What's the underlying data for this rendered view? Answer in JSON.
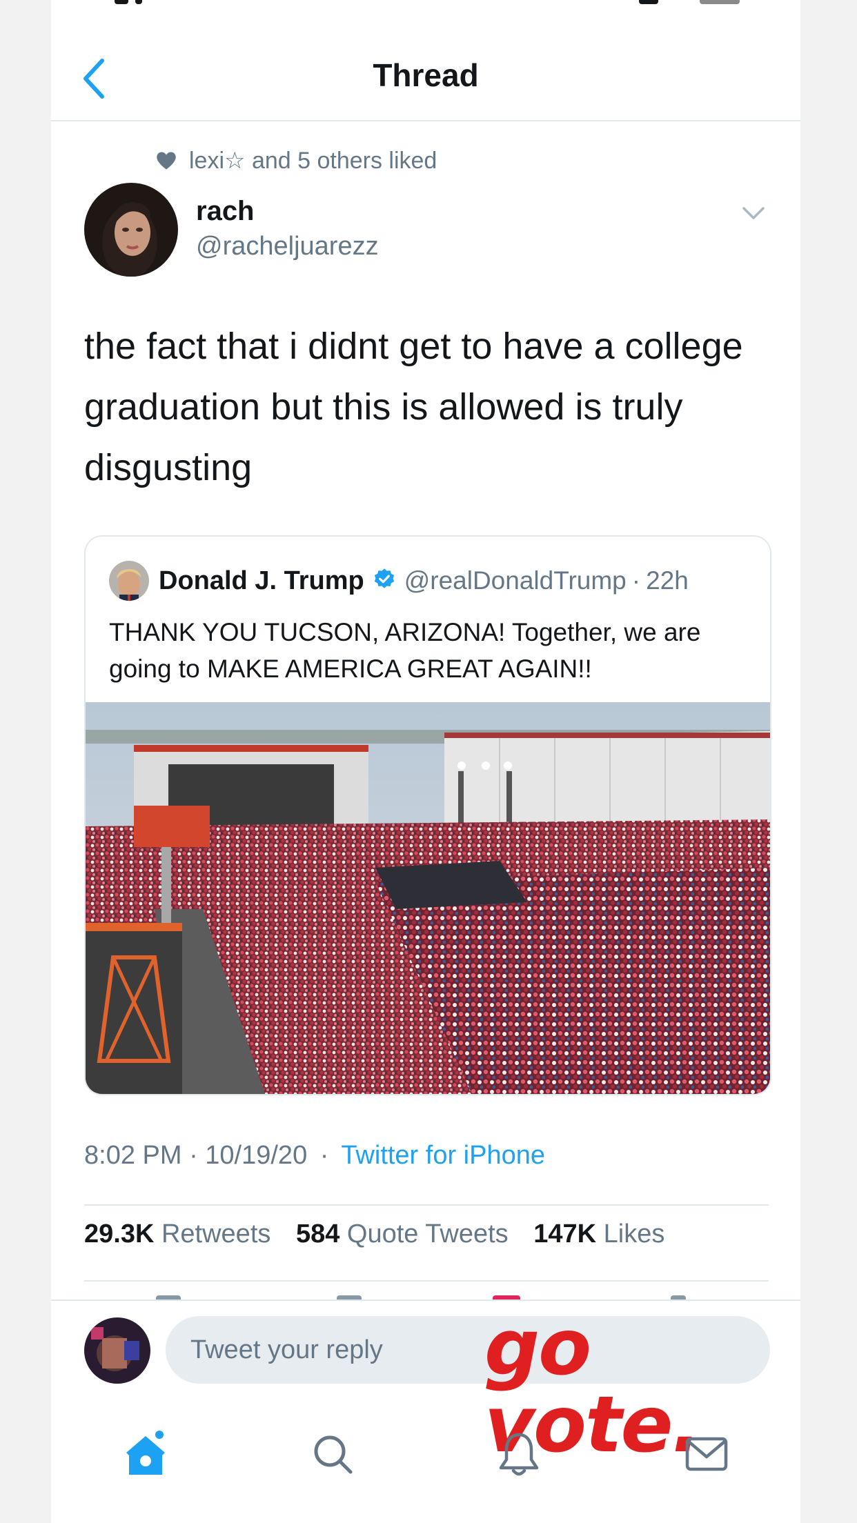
{
  "header": {
    "title": "Thread"
  },
  "social_context": {
    "text": "lexi☆ and 5 others liked"
  },
  "tweet": {
    "author_name": "rach",
    "author_handle": "@racheljuarezz",
    "text": "the fact that i didnt get to have a college graduation but this is allowed is truly disgusting",
    "timestamp": "8:02 PM · 10/19/20",
    "separator": "·",
    "source": "Twitter for iPhone"
  },
  "quoted_tweet": {
    "author_name": "Donald J. Trump",
    "author_handle": "@realDonaldTrump",
    "separator": "·",
    "time": "22h",
    "text": "THANK YOU TUCSON, ARIZONA! Together, we are going to MAKE AMERICA GREAT AGAIN!!"
  },
  "stats": {
    "retweets_count": "29.3K",
    "retweets_label": "Retweets",
    "quotes_count": "584",
    "quotes_label": "Quote Tweets",
    "likes_count": "147K",
    "likes_label": "Likes"
  },
  "reply": {
    "placeholder": "Tweet your reply"
  },
  "overlay": {
    "text": "go vote."
  },
  "tab_bar": {
    "items": [
      "home-icon",
      "search-icon",
      "bell-icon",
      "mail-icon"
    ]
  },
  "colors": {
    "accent": "#1da1f2",
    "overlay": "#e02020",
    "secondary_text": "#657786",
    "divider": "#e1e8ed"
  }
}
